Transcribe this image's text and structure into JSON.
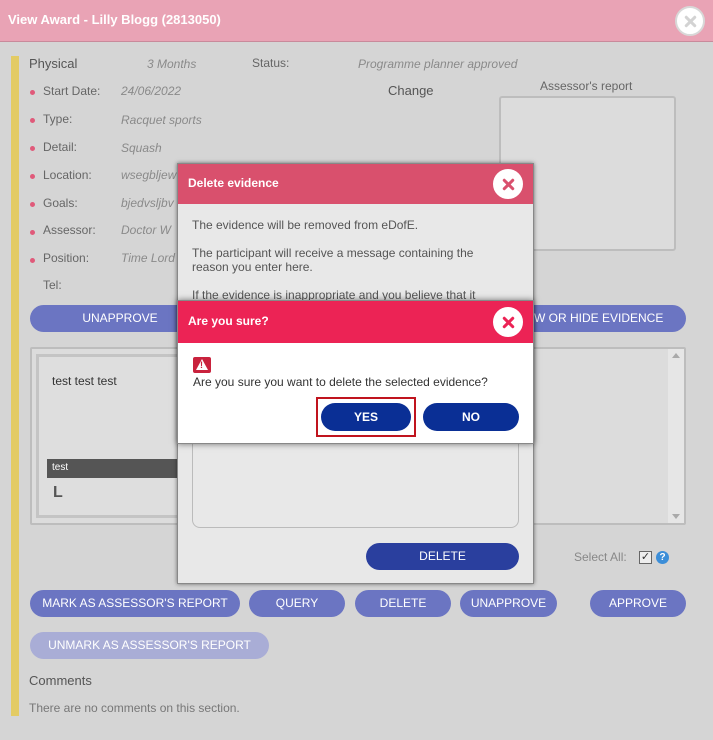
{
  "window": {
    "title": "View Award - Lilly Blogg (2813050)"
  },
  "award": {
    "level_label": "Physical",
    "duration": "3 Months",
    "status_label": "Status:",
    "status_value": "Programme planner approved",
    "change_label": "Change",
    "assessor_report_label": "Assessor's report",
    "fields": [
      {
        "label": "Start Date:",
        "value": "24/06/2022"
      },
      {
        "label": "Type:",
        "value": "Racquet sports"
      },
      {
        "label": "Detail:",
        "value": "Squash"
      },
      {
        "label": "Location:",
        "value": "wsegbljew"
      },
      {
        "label": "Goals:",
        "value": "bjedvsljbv"
      },
      {
        "label": "Assessor:",
        "value": "Doctor W"
      },
      {
        "label": "Position:",
        "value": "Time Lord"
      },
      {
        "label": "Tel:",
        "value": ""
      }
    ]
  },
  "buttons": {
    "unapprove_top": "UNAPPROVE",
    "view_hide": "W OR HIDE EVIDENCE",
    "mark_assessor": "MARK AS ASSESSOR'S REPORT",
    "query": "QUERY",
    "delete": "DELETE",
    "unapprove": "UNAPPROVE",
    "approve": "APPROVE",
    "unmark_assessor": "UNMARK AS ASSESSOR'S REPORT"
  },
  "evidence": {
    "card_text": "test test test",
    "card_caption": "test",
    "card_letter": "L",
    "select_all": "Select All:"
  },
  "comments": {
    "heading": "Comments",
    "empty": "There are no comments on this section."
  },
  "delete_dialog": {
    "title": "Delete evidence",
    "line1": "The evidence will be removed from eDofE.",
    "line2": "The participant will receive a message containing the reason you enter here.",
    "line3": "If the evidence is inappropriate and you believe that it",
    "delete_button": "DELETE"
  },
  "confirm_dialog": {
    "title": "Are you sure?",
    "message": "Are you sure you want to delete the selected evidence?",
    "yes": "YES",
    "no": "NO"
  },
  "colors": {
    "title_bar": "#e9a3b5",
    "delete_header": "#d9506d",
    "confirm_header": "#ec2355",
    "primary_button": "#0a2f95",
    "pill_button": "#6b75c2",
    "highlight_border": "#c0141e"
  }
}
